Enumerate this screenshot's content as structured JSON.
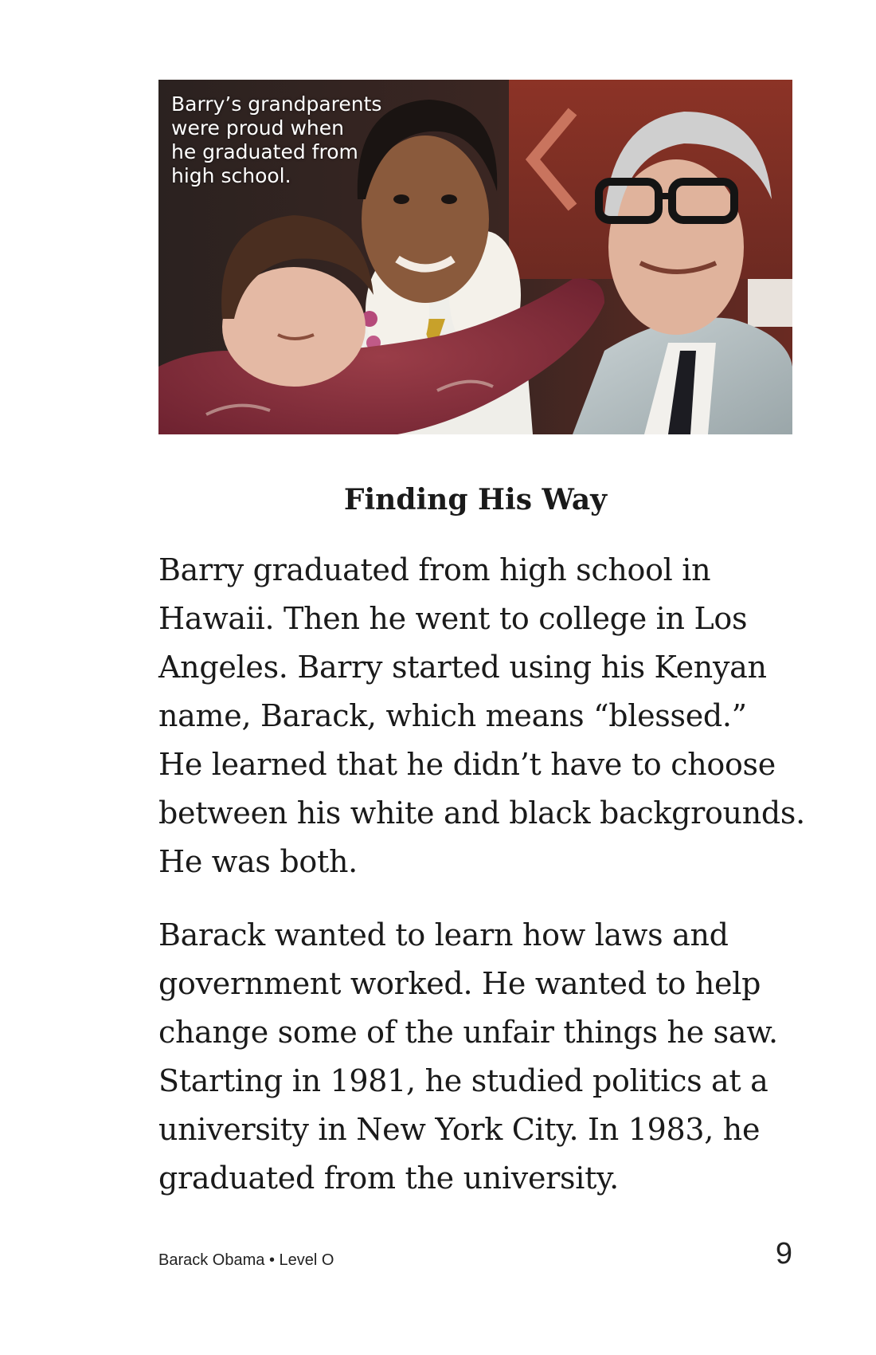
{
  "photo": {
    "caption": "Barry’s grandparents\nwere proud when\nhe graduated from\nhigh school."
  },
  "section": {
    "heading": "Finding His Way",
    "paragraphs": [
      "Barry graduated from high school in\nHawaii. Then he went to college in Los\nAngeles. Barry started using his Kenyan\nname, Barack, which means “blessed.”\nHe learned that he didn’t have to choose\nbetween his white and black backgrounds.\nHe was both.",
      "Barack wanted to learn how laws and\ngovernment worked. He wanted to help\nchange some of the unfair things he saw.\nStarting in 1981, he studied politics at a\nuniversity in New York City. In 1983, he\ngraduated from the university."
    ]
  },
  "footer": {
    "book_info": "Barack Obama • Level O",
    "page_number": "9"
  }
}
